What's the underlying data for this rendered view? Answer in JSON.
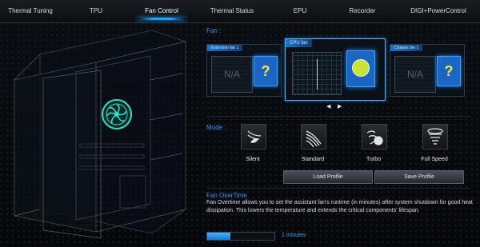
{
  "nav": {
    "tabs": [
      {
        "label": "Thermal Tuning"
      },
      {
        "label": "TPU"
      },
      {
        "label": "Fan Control"
      },
      {
        "label": "Thermal Status"
      },
      {
        "label": "EPU"
      },
      {
        "label": "Recorder"
      },
      {
        "label": "DIGI+PowerControl"
      }
    ],
    "active_tab": "Fan Control"
  },
  "fan_section": {
    "title": "Fan :",
    "cards": [
      {
        "tag": "Extension fan 1",
        "value": "N/A",
        "icon": "unknown-fan-icon"
      },
      {
        "tag": "CPU fan",
        "icon": "cpu-fan-icon"
      },
      {
        "tag": "Chassis fan 1",
        "value": "N/A",
        "icon": "unknown-fan-icon"
      }
    ],
    "prev_label": "◀",
    "next_label": "▶"
  },
  "mode_section": {
    "title": "Mode :",
    "modes": [
      {
        "label": "Silent",
        "icon": "leaf-icon"
      },
      {
        "label": "Standard",
        "icon": "wind-icon"
      },
      {
        "label": "Turbo",
        "icon": "swirl-icon"
      },
      {
        "label": "Full Speed",
        "icon": "tornado-icon"
      }
    ],
    "load_profile": "Load Profile",
    "save_profile": "Save Profile"
  },
  "overtime": {
    "title": "Fan OverTime",
    "description": "Fan Overtime allows you to set the assistant fan's runtime (in minutes) after system shutdown for good heat dissipation. This lowers the temperature and extends the critical components' lifespan.",
    "value_label": "1 minutes",
    "progress": 0.35
  },
  "colors": {
    "accent": "#2b9bff",
    "fan_glow": "#2de0c8"
  }
}
